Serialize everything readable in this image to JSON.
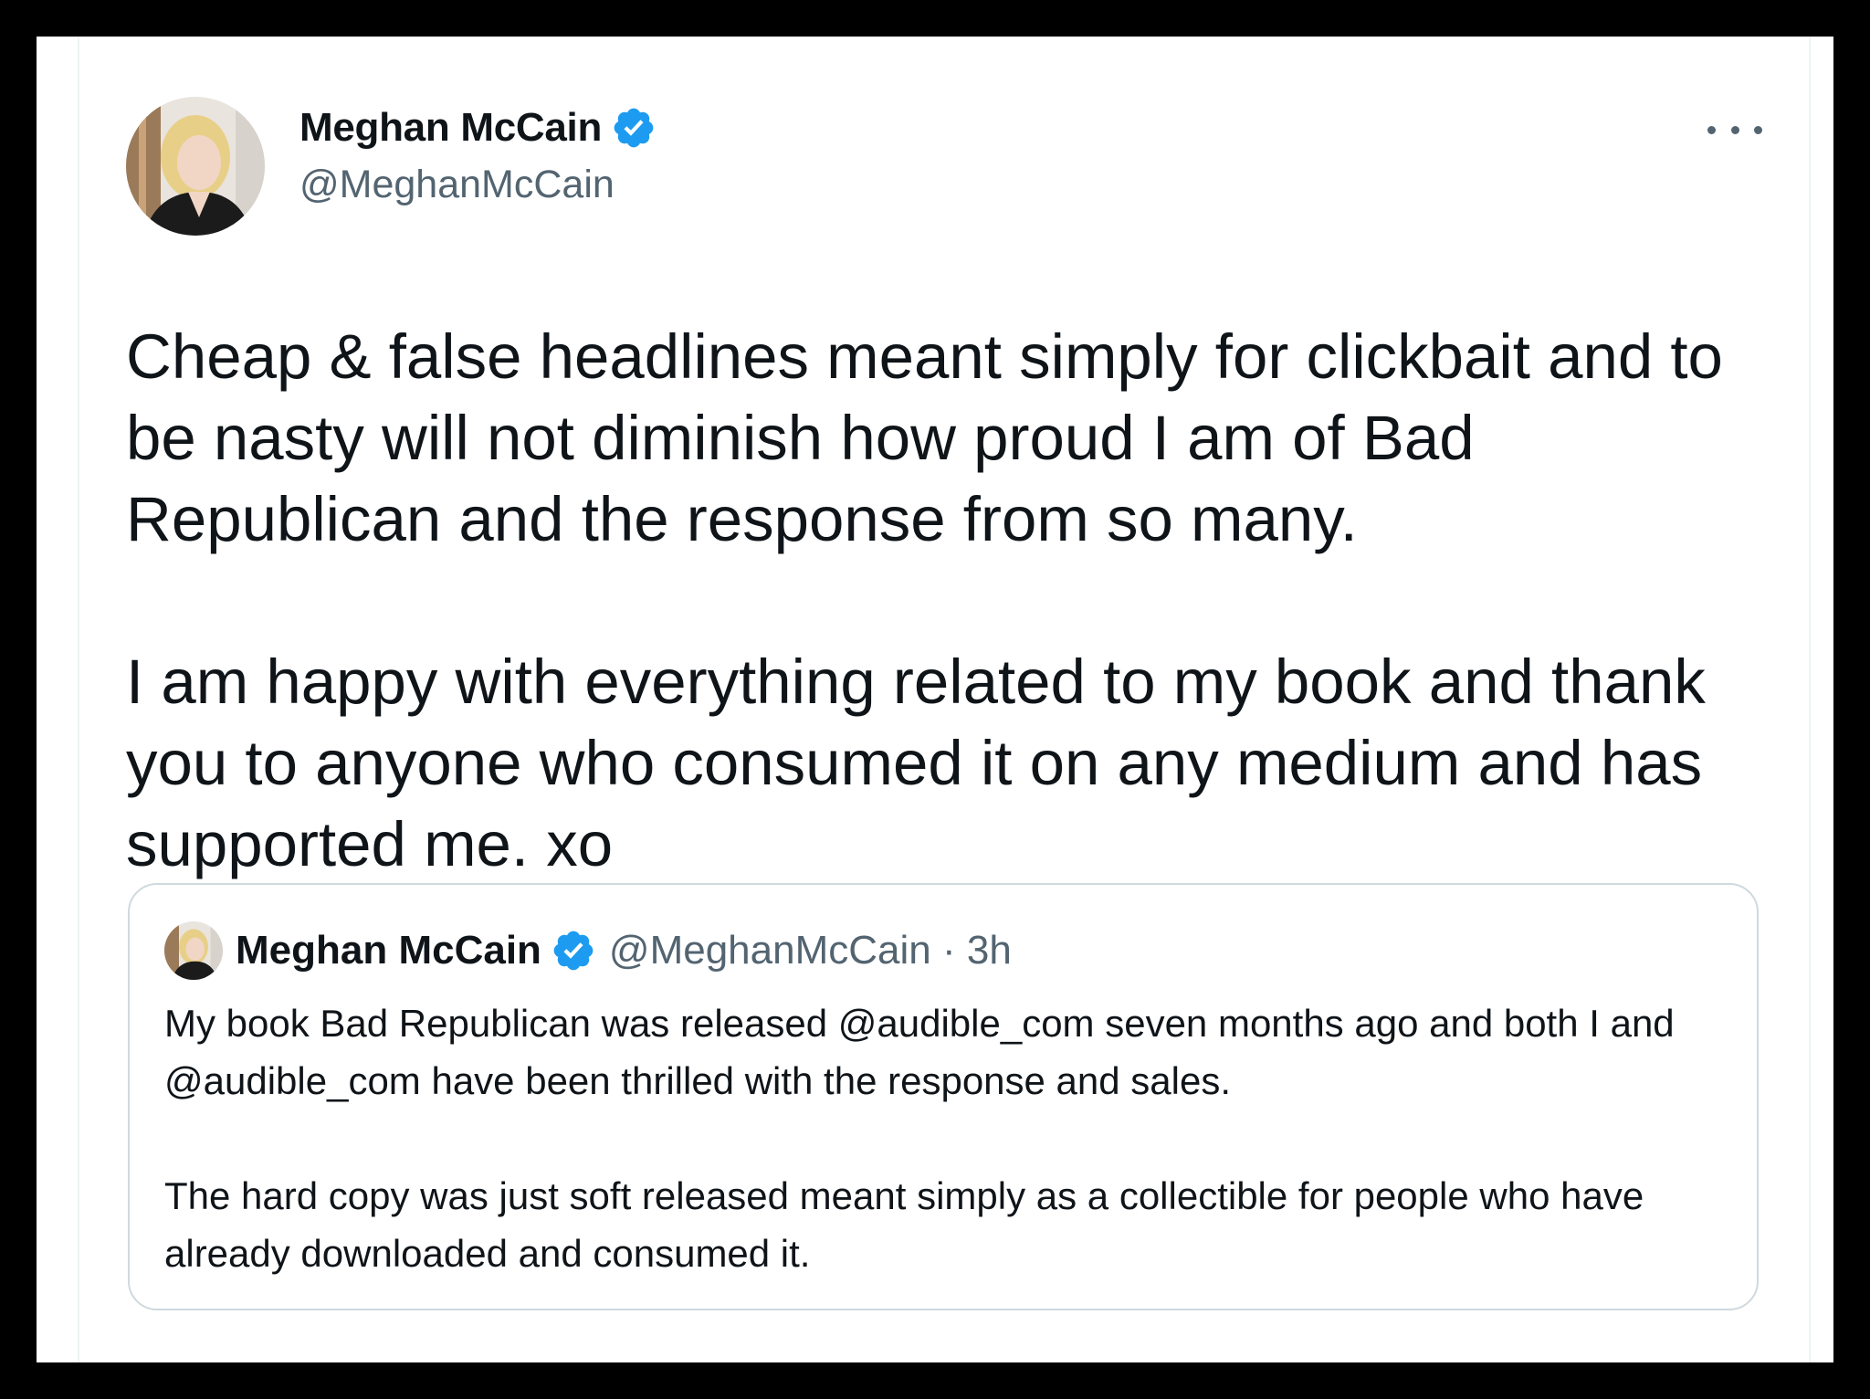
{
  "author": {
    "display_name": "Meghan McCain",
    "handle": "@MeghanMcCain",
    "verified": true
  },
  "tweet": {
    "paragraphs": [
      "Cheap & false headlines meant simply for clickbait and to be nasty will not diminish how proud I am of Bad Republican and the response from so many.",
      "I am happy with everything related to my book and thank you to anyone who consumed it on any medium and has supported me. xo"
    ]
  },
  "quoted_tweet": {
    "display_name": "Meghan McCain",
    "handle": "@MeghanMcCain",
    "separator": "·",
    "time": "3h",
    "paragraphs": [
      "My book Bad Republican was released @audible_com seven months ago and both I and @audible_com have been thrilled with the response and sales.",
      "The hard copy was just soft released meant simply as a collectible for people who have already downloaded and consumed it."
    ]
  },
  "icons": {
    "verified": "verified-badge-icon",
    "more": "more-options-icon"
  },
  "colors": {
    "text_primary": "#0f1419",
    "text_secondary": "#536471",
    "verified_blue": "#1d9bf0",
    "border": "#cfd9de",
    "frame": "#000000"
  }
}
